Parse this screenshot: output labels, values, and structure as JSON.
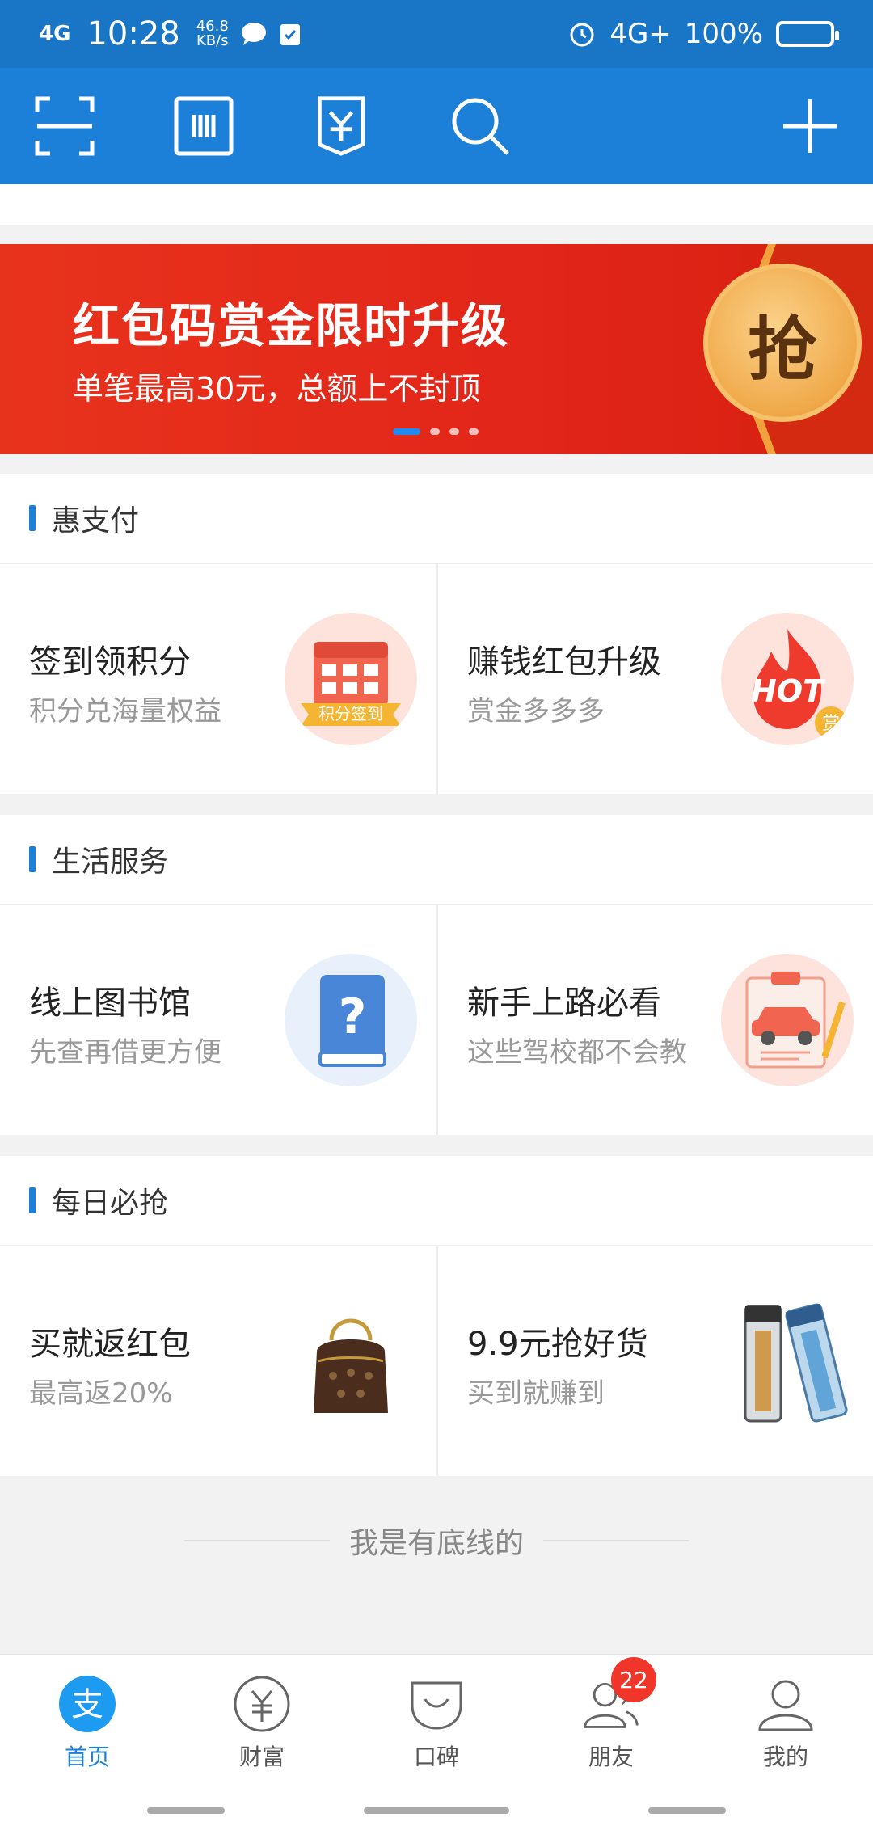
{
  "status_bar": {
    "signal": "4G",
    "time": "10:28",
    "speed_value": "46.8",
    "speed_unit": "KB/s",
    "network": "4G+",
    "battery": "100%"
  },
  "toolbar": {
    "icons": [
      "scan-icon",
      "barcode-icon",
      "receipt-yuan-icon",
      "search-icon",
      "plus-icon"
    ]
  },
  "banner": {
    "title": "红包码赏金限时升级",
    "subtitle": "单笔最高30元，总额上不封顶",
    "badge": "抢",
    "page_index": 1,
    "page_count": 4
  },
  "sections": [
    {
      "title": "惠支付",
      "cards": [
        {
          "title": "签到领积分",
          "subtitle": "积分兑海量权益",
          "badge_text": "积分签到"
        },
        {
          "title": "赚钱红包升级",
          "subtitle": "赏金多多多",
          "badge_text": "HOT",
          "badge_sub": "赏"
        }
      ]
    },
    {
      "title": "生活服务",
      "cards": [
        {
          "title": "线上图书馆",
          "subtitle": "先查再借更方便",
          "badge_text": "?"
        },
        {
          "title": "新手上路必看",
          "subtitle": "这些驾校都不会教"
        }
      ]
    },
    {
      "title": "每日必抢",
      "cards": [
        {
          "title": "买就返红包",
          "subtitle": "最高返20%"
        },
        {
          "title": "9.9元抢好货",
          "subtitle": "买到就赚到"
        }
      ]
    }
  ],
  "footer": {
    "text": "我是有底线的"
  },
  "bottom_nav": [
    {
      "label": "首页",
      "icon": "alipay-icon",
      "active": true
    },
    {
      "label": "财富",
      "icon": "yuan-circle-icon"
    },
    {
      "label": "口碑",
      "icon": "koubei-icon"
    },
    {
      "label": "朋友",
      "icon": "friends-icon",
      "badge": "22"
    },
    {
      "label": "我的",
      "icon": "profile-icon"
    }
  ],
  "colors": {
    "primary": "#1c7fd8",
    "banner_red": "#e2261a",
    "badge_red": "#f0362a"
  }
}
